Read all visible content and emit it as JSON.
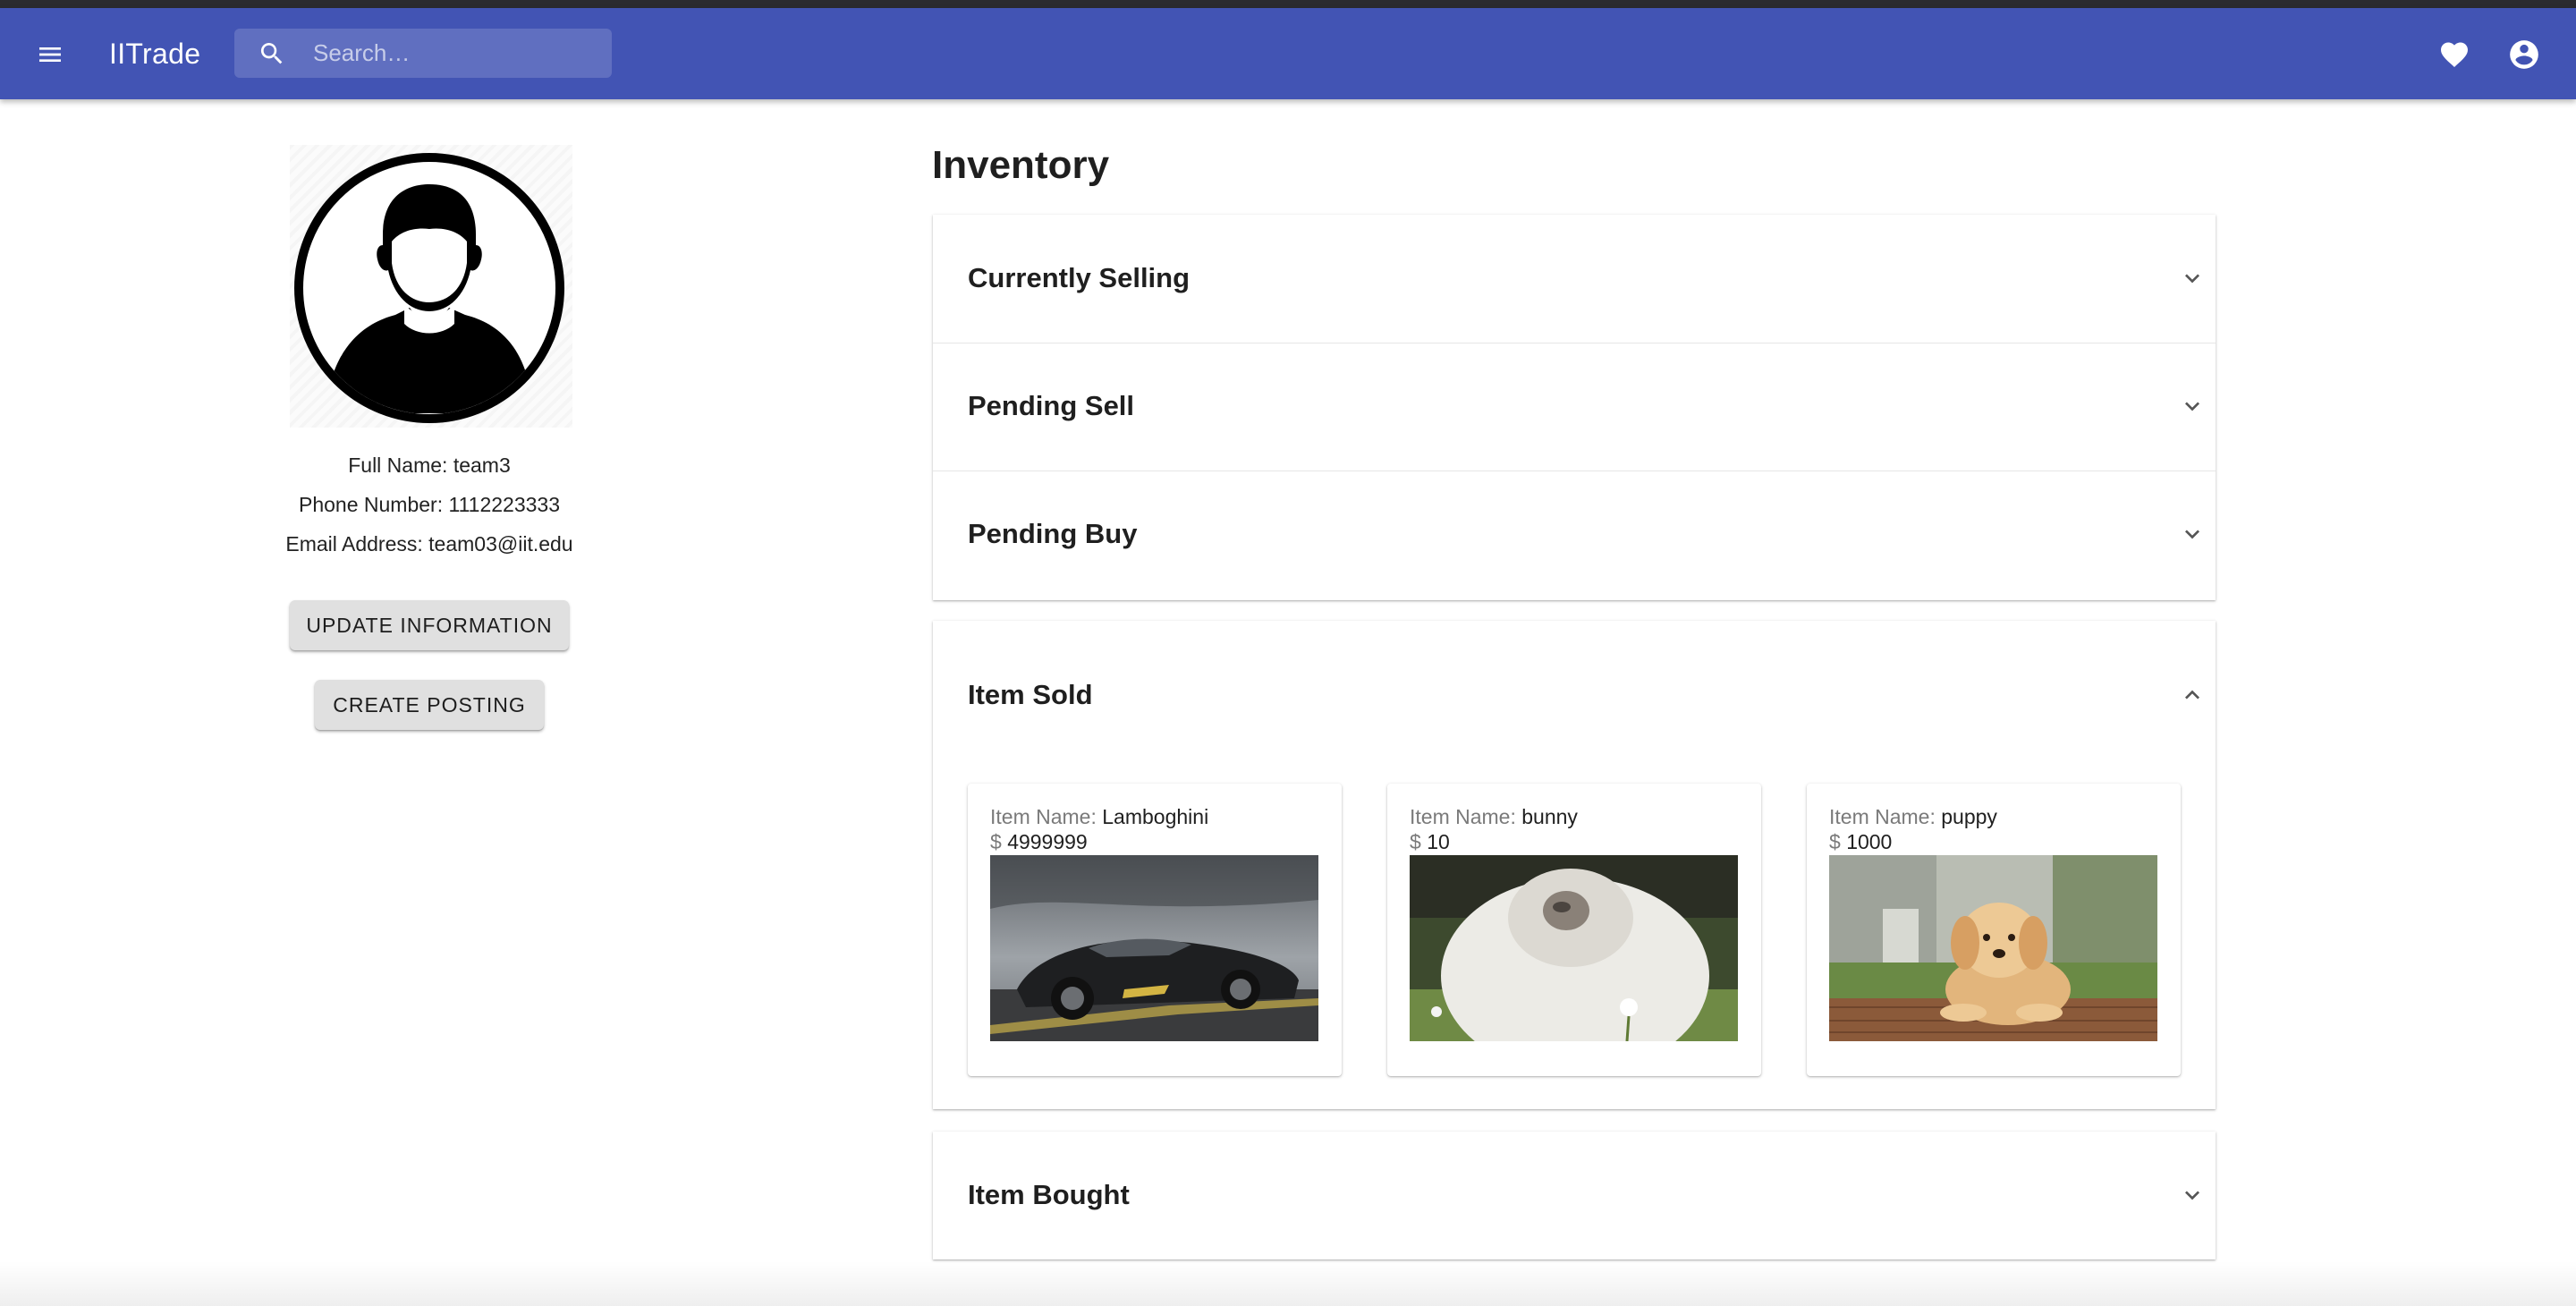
{
  "app": {
    "title": "IITrade",
    "search_placeholder": "Search…",
    "brand_color": "#4254b4",
    "icons": {
      "menu": "menu-icon",
      "search": "search-icon",
      "favorites": "heart-icon",
      "account": "account-circle-icon"
    }
  },
  "profile": {
    "full_name": "Full Name: team3",
    "phone": "Phone Number: 1112223333",
    "email": "Email Address: team03@iit.edu",
    "update_button": "UPDATE INFORMATION",
    "create_button": "CREATE POSTING"
  },
  "inventory": {
    "title": "Inventory",
    "sections": [
      {
        "label": "Currently Selling",
        "expanded": false
      },
      {
        "label": "Pending Sell",
        "expanded": false
      },
      {
        "label": "Pending Buy",
        "expanded": false
      },
      {
        "label": "Item Sold",
        "expanded": true
      },
      {
        "label": "Item Bought",
        "expanded": false
      }
    ],
    "item_name_label": "Item Name:",
    "currency": "$",
    "sold_items": [
      {
        "name": "Lamboghini",
        "price": "4999999",
        "image": "sports-car-photo"
      },
      {
        "name": "bunny",
        "price": "10",
        "image": "rabbit-photo"
      },
      {
        "name": "puppy",
        "price": "1000",
        "image": "golden-retriever-puppy-photo"
      }
    ]
  }
}
